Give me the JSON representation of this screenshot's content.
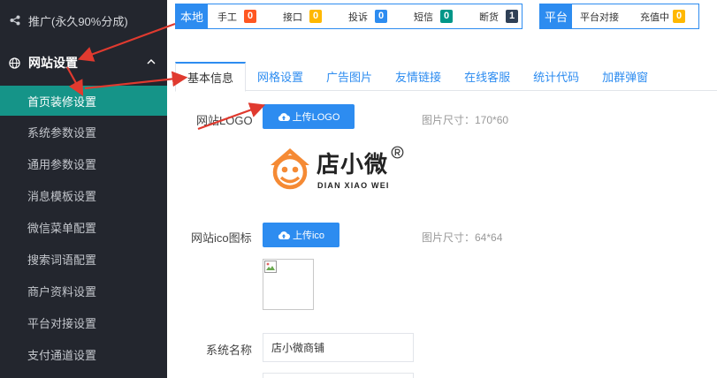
{
  "sidebar": {
    "promo_label": "推广(永久90%分成)",
    "group_label": "网站设置",
    "items": [
      {
        "label": "首页装修设置"
      },
      {
        "label": "系统参数设置"
      },
      {
        "label": "通用参数设置"
      },
      {
        "label": "消息模板设置"
      },
      {
        "label": "微信菜单配置"
      },
      {
        "label": "搜索词语配置"
      },
      {
        "label": "商户资料设置"
      },
      {
        "label": "平台对接设置"
      },
      {
        "label": "支付通道设置"
      }
    ]
  },
  "local_bar": {
    "tag": "本地",
    "stats": [
      {
        "label": "手工",
        "count": "0",
        "color": "#ff5722"
      },
      {
        "label": "接口",
        "count": "0",
        "color": "#ffb800"
      },
      {
        "label": "投诉",
        "count": "0",
        "color": "#2d8cf0"
      },
      {
        "label": "短信",
        "count": "0",
        "color": "#009688"
      },
      {
        "label": "断货",
        "count": "1",
        "color": "#2f4056"
      }
    ]
  },
  "platform_bar": {
    "tag": "平台",
    "stats": [
      {
        "label": "平台对接",
        "count": ""
      },
      {
        "label": "充值中",
        "count": "0",
        "color": "#ffb800"
      }
    ]
  },
  "tabs": [
    {
      "label": "基本信息"
    },
    {
      "label": "网格设置"
    },
    {
      "label": "广告图片"
    },
    {
      "label": "友情链接"
    },
    {
      "label": "在线客服"
    },
    {
      "label": "统计代码"
    },
    {
      "label": "加群弹窗"
    }
  ],
  "form": {
    "logo_label": "网站LOGO",
    "logo_button": "上传LOGO",
    "logo_hint": "图片尺寸：170*60",
    "logo_brand": "店小微",
    "logo_sub": "DIAN XIAO WEI",
    "ico_label": "网站ico图标",
    "ico_button": "上传ico",
    "ico_hint": "图片尺寸：64*64",
    "system_name_label": "系统名称",
    "system_name_value": "店小微商铺"
  },
  "colors": {
    "primary": "#2d8cf0",
    "active": "#159488",
    "sidebar": "#23262e",
    "arrow": "#e03a2f"
  }
}
